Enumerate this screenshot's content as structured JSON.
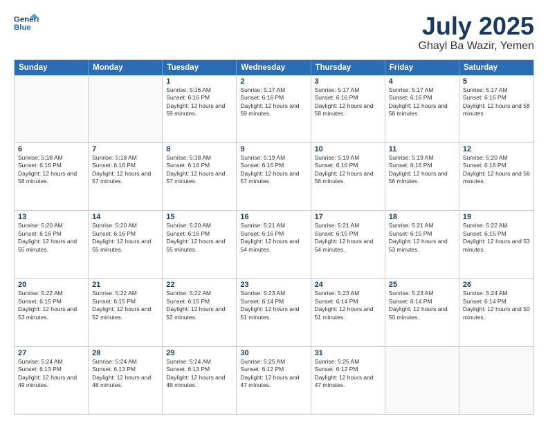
{
  "header": {
    "logo_line1": "General",
    "logo_line2": "Blue",
    "title": "July 2025",
    "subtitle": "Ghayl Ba Wazir, Yemen"
  },
  "days_of_week": [
    "Sunday",
    "Monday",
    "Tuesday",
    "Wednesday",
    "Thursday",
    "Friday",
    "Saturday"
  ],
  "weeks": [
    [
      {
        "day": "",
        "sunrise": "",
        "sunset": "",
        "daylight": "",
        "empty": true
      },
      {
        "day": "",
        "sunrise": "",
        "sunset": "",
        "daylight": "",
        "empty": true
      },
      {
        "day": "1",
        "sunrise": "Sunrise: 5:16 AM",
        "sunset": "Sunset: 6:16 PM",
        "daylight": "Daylight: 12 hours and 59 minutes.",
        "empty": false
      },
      {
        "day": "2",
        "sunrise": "Sunrise: 5:17 AM",
        "sunset": "Sunset: 6:16 PM",
        "daylight": "Daylight: 12 hours and 59 minutes.",
        "empty": false
      },
      {
        "day": "3",
        "sunrise": "Sunrise: 5:17 AM",
        "sunset": "Sunset: 6:16 PM",
        "daylight": "Daylight: 12 hours and 58 minutes.",
        "empty": false
      },
      {
        "day": "4",
        "sunrise": "Sunrise: 5:17 AM",
        "sunset": "Sunset: 6:16 PM",
        "daylight": "Daylight: 12 hours and 58 minutes.",
        "empty": false
      },
      {
        "day": "5",
        "sunrise": "Sunrise: 5:17 AM",
        "sunset": "Sunset: 6:16 PM",
        "daylight": "Daylight: 12 hours and 58 minutes.",
        "empty": false
      }
    ],
    [
      {
        "day": "6",
        "sunrise": "Sunrise: 5:18 AM",
        "sunset": "Sunset: 6:16 PM",
        "daylight": "Daylight: 12 hours and 58 minutes.",
        "empty": false
      },
      {
        "day": "7",
        "sunrise": "Sunrise: 5:18 AM",
        "sunset": "Sunset: 6:16 PM",
        "daylight": "Daylight: 12 hours and 57 minutes.",
        "empty": false
      },
      {
        "day": "8",
        "sunrise": "Sunrise: 5:18 AM",
        "sunset": "Sunset: 6:16 PM",
        "daylight": "Daylight: 12 hours and 57 minutes.",
        "empty": false
      },
      {
        "day": "9",
        "sunrise": "Sunrise: 5:19 AM",
        "sunset": "Sunset: 6:16 PM",
        "daylight": "Daylight: 12 hours and 57 minutes.",
        "empty": false
      },
      {
        "day": "10",
        "sunrise": "Sunrise: 5:19 AM",
        "sunset": "Sunset: 6:16 PM",
        "daylight": "Daylight: 12 hours and 56 minutes.",
        "empty": false
      },
      {
        "day": "11",
        "sunrise": "Sunrise: 5:19 AM",
        "sunset": "Sunset: 6:16 PM",
        "daylight": "Daylight: 12 hours and 56 minutes.",
        "empty": false
      },
      {
        "day": "12",
        "sunrise": "Sunrise: 5:20 AM",
        "sunset": "Sunset: 6:16 PM",
        "daylight": "Daylight: 12 hours and 56 minutes.",
        "empty": false
      }
    ],
    [
      {
        "day": "13",
        "sunrise": "Sunrise: 5:20 AM",
        "sunset": "Sunset: 6:16 PM",
        "daylight": "Daylight: 12 hours and 55 minutes.",
        "empty": false
      },
      {
        "day": "14",
        "sunrise": "Sunrise: 5:20 AM",
        "sunset": "Sunset: 6:16 PM",
        "daylight": "Daylight: 12 hours and 55 minutes.",
        "empty": false
      },
      {
        "day": "15",
        "sunrise": "Sunrise: 5:20 AM",
        "sunset": "Sunset: 6:16 PM",
        "daylight": "Daylight: 12 hours and 55 minutes.",
        "empty": false
      },
      {
        "day": "16",
        "sunrise": "Sunrise: 5:21 AM",
        "sunset": "Sunset: 6:16 PM",
        "daylight": "Daylight: 12 hours and 54 minutes.",
        "empty": false
      },
      {
        "day": "17",
        "sunrise": "Sunrise: 5:21 AM",
        "sunset": "Sunset: 6:15 PM",
        "daylight": "Daylight: 12 hours and 54 minutes.",
        "empty": false
      },
      {
        "day": "18",
        "sunrise": "Sunrise: 5:21 AM",
        "sunset": "Sunset: 6:15 PM",
        "daylight": "Daylight: 12 hours and 53 minutes.",
        "empty": false
      },
      {
        "day": "19",
        "sunrise": "Sunrise: 5:22 AM",
        "sunset": "Sunset: 6:15 PM",
        "daylight": "Daylight: 12 hours and 53 minutes.",
        "empty": false
      }
    ],
    [
      {
        "day": "20",
        "sunrise": "Sunrise: 5:22 AM",
        "sunset": "Sunset: 6:15 PM",
        "daylight": "Daylight: 12 hours and 53 minutes.",
        "empty": false
      },
      {
        "day": "21",
        "sunrise": "Sunrise: 5:22 AM",
        "sunset": "Sunset: 6:15 PM",
        "daylight": "Daylight: 12 hours and 52 minutes.",
        "empty": false
      },
      {
        "day": "22",
        "sunrise": "Sunrise: 5:22 AM",
        "sunset": "Sunset: 6:15 PM",
        "daylight": "Daylight: 12 hours and 52 minutes.",
        "empty": false
      },
      {
        "day": "23",
        "sunrise": "Sunrise: 5:23 AM",
        "sunset": "Sunset: 6:14 PM",
        "daylight": "Daylight: 12 hours and 51 minutes.",
        "empty": false
      },
      {
        "day": "24",
        "sunrise": "Sunrise: 5:23 AM",
        "sunset": "Sunset: 6:14 PM",
        "daylight": "Daylight: 12 hours and 51 minutes.",
        "empty": false
      },
      {
        "day": "25",
        "sunrise": "Sunrise: 5:23 AM",
        "sunset": "Sunset: 6:14 PM",
        "daylight": "Daylight: 12 hours and 50 minutes.",
        "empty": false
      },
      {
        "day": "26",
        "sunrise": "Sunrise: 5:24 AM",
        "sunset": "Sunset: 6:14 PM",
        "daylight": "Daylight: 12 hours and 50 minutes.",
        "empty": false
      }
    ],
    [
      {
        "day": "27",
        "sunrise": "Sunrise: 5:24 AM",
        "sunset": "Sunset: 6:13 PM",
        "daylight": "Daylight: 12 hours and 49 minutes.",
        "empty": false
      },
      {
        "day": "28",
        "sunrise": "Sunrise: 5:24 AM",
        "sunset": "Sunset: 6:13 PM",
        "daylight": "Daylight: 12 hours and 48 minutes.",
        "empty": false
      },
      {
        "day": "29",
        "sunrise": "Sunrise: 5:24 AM",
        "sunset": "Sunset: 6:13 PM",
        "daylight": "Daylight: 12 hours and 48 minutes.",
        "empty": false
      },
      {
        "day": "30",
        "sunrise": "Sunrise: 5:25 AM",
        "sunset": "Sunset: 6:12 PM",
        "daylight": "Daylight: 12 hours and 47 minutes.",
        "empty": false
      },
      {
        "day": "31",
        "sunrise": "Sunrise: 5:25 AM",
        "sunset": "Sunset: 6:12 PM",
        "daylight": "Daylight: 12 hours and 47 minutes.",
        "empty": false
      },
      {
        "day": "",
        "sunrise": "",
        "sunset": "",
        "daylight": "",
        "empty": true
      },
      {
        "day": "",
        "sunrise": "",
        "sunset": "",
        "daylight": "",
        "empty": true
      }
    ]
  ]
}
